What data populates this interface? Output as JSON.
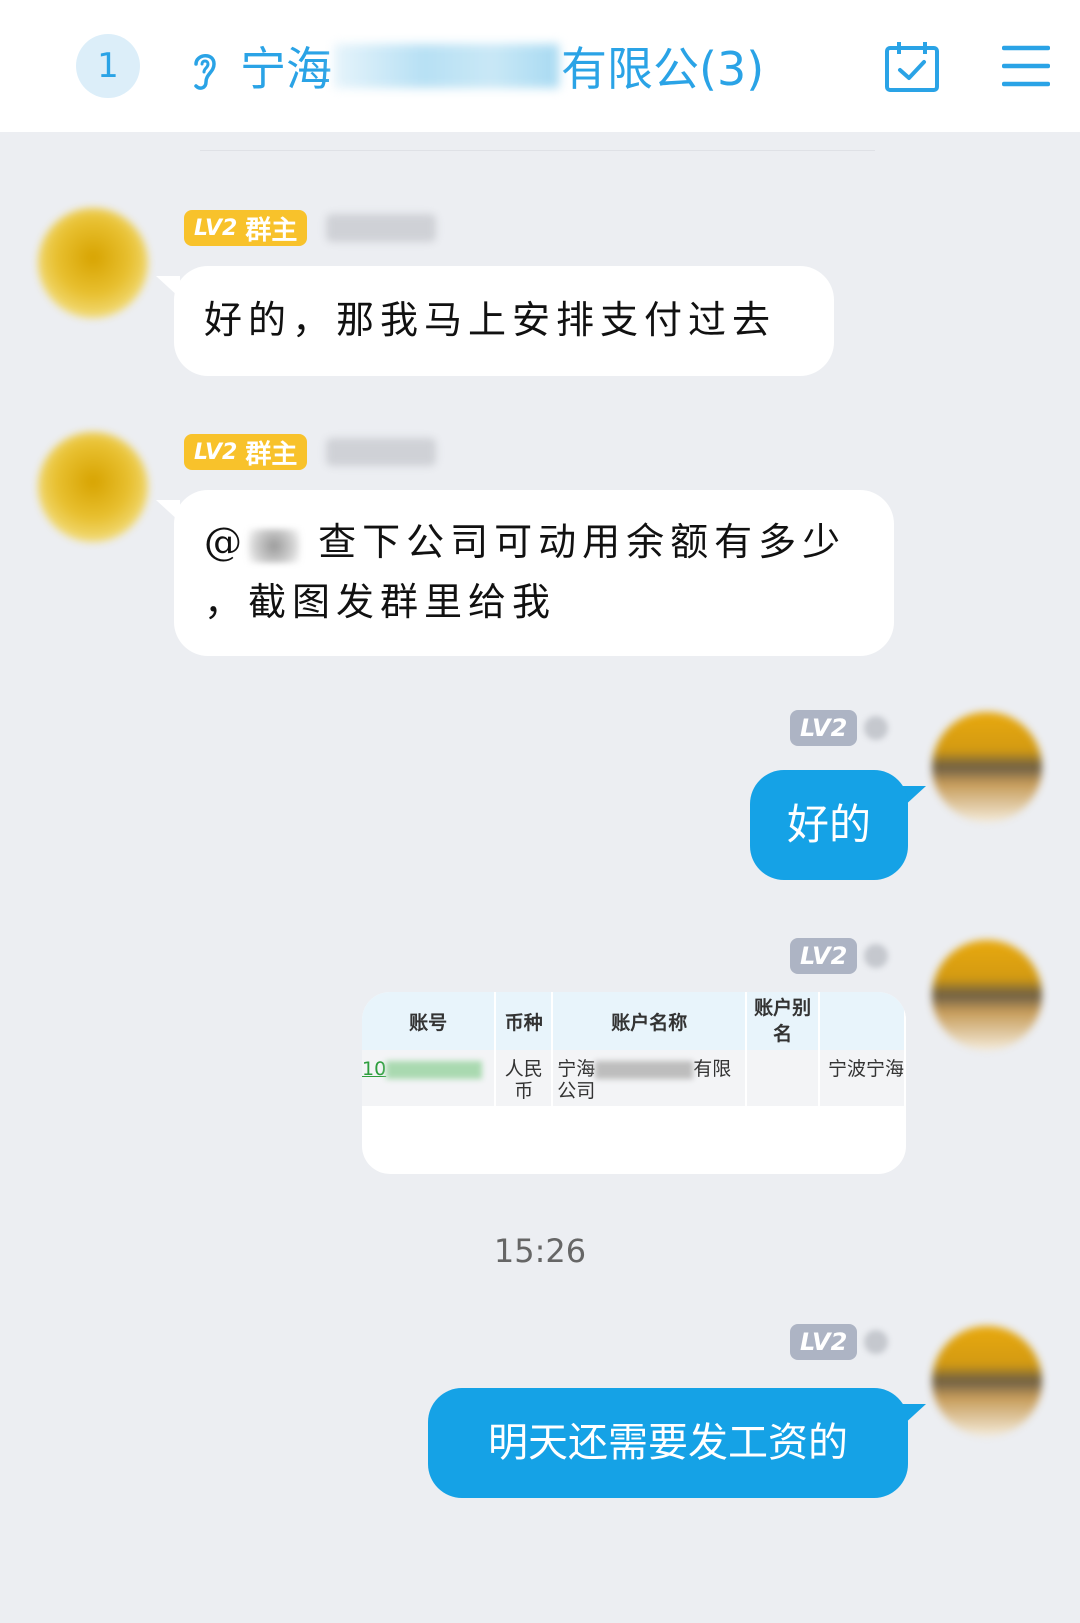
{
  "header": {
    "unread_count": "1",
    "title_prefix": "宁海",
    "title_suffix": "有限公(3)",
    "icons": [
      "ear-icon",
      "calendar-check-icon",
      "menu-icon"
    ]
  },
  "messages": [
    {
      "badge_level": "LV2",
      "badge_role": "群主",
      "text": "好的，那我马上安排支付过去"
    },
    {
      "badge_level": "LV2",
      "badge_role": "群主",
      "mention": "@",
      "line1": "查下公司可动用余额有多少",
      "line2": "，截图发群里给我"
    },
    {
      "badge_level": "LV2",
      "text": "好的"
    },
    {
      "badge_level": "LV2",
      "card": {
        "headers": [
          "账号",
          "币种",
          "账户名称",
          "账户别名",
          ""
        ],
        "row": {
          "account": "10",
          "currency": "人民币",
          "name_prefix": "宁海",
          "name_suffix": "有限公司",
          "alias": "",
          "bank": "宁波宁海"
        }
      }
    },
    {
      "badge_level": "LV2",
      "text": "明天还需要发工资的"
    }
  ],
  "timestamp": "15:26",
  "colors": {
    "accent": "#2aa3e6",
    "outgoing_bubble": "#15a2e6",
    "owner_badge": "#f8c22b",
    "level_badge": "#adb4c4",
    "background": "#eceef2"
  }
}
